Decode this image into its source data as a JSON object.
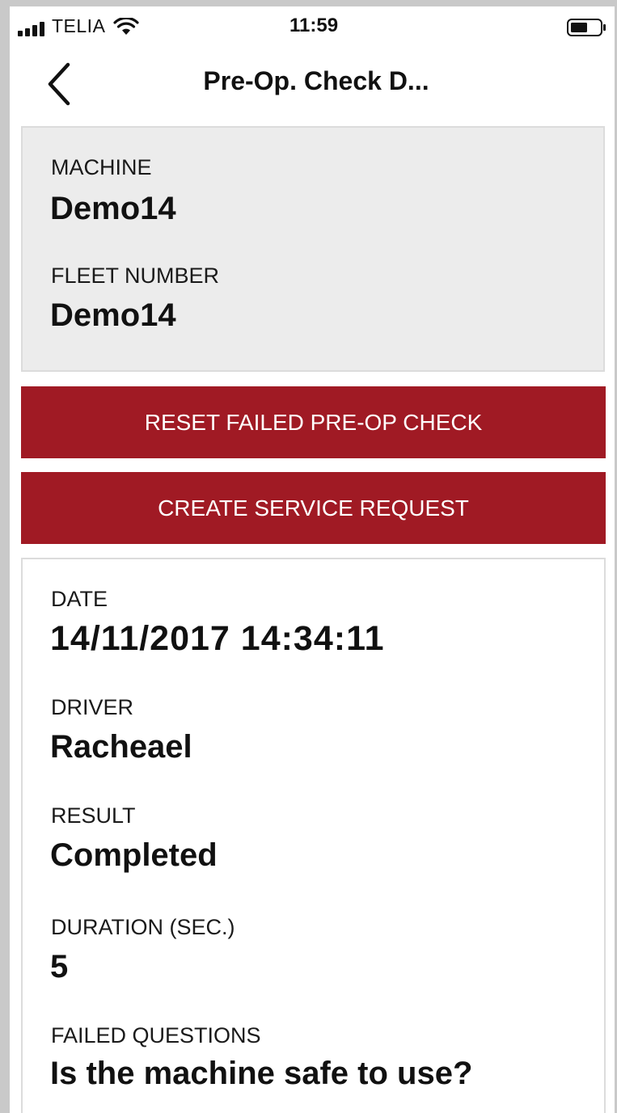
{
  "status_bar": {
    "carrier": "TELIA",
    "time": "11:59"
  },
  "nav": {
    "title": "Pre-Op. Check D..."
  },
  "machine_card": {
    "machine_label": "MACHINE",
    "machine_value": "Demo14",
    "fleet_label": "FLEET NUMBER",
    "fleet_value": "Demo14"
  },
  "actions": {
    "reset_label": "RESET FAILED PRE-OP CHECK",
    "service_label": "CREATE SERVICE REQUEST",
    "button_color": "#a01a24"
  },
  "details": {
    "date_label": "DATE",
    "date_value": "14/11/2017 14:34:11",
    "driver_label": "DRIVER",
    "driver_value": "Racheael",
    "result_label": "RESULT",
    "result_value": "Completed",
    "duration_label": "DURATION (SEC.)",
    "duration_value": "5",
    "failed_label": "FAILED QUESTIONS",
    "failed_value": "Is the machine safe to use?"
  },
  "icons": {
    "signal": "signal-bars-icon",
    "wifi": "wifi-icon",
    "battery": "battery-icon",
    "back": "chevron-left-icon"
  }
}
